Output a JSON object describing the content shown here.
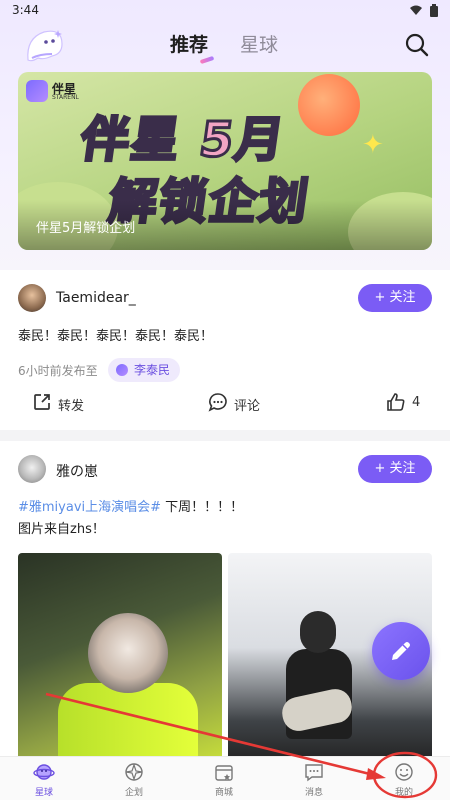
{
  "status": {
    "time": "3:44"
  },
  "header": {
    "tabs": [
      {
        "label": "推荐",
        "active": true
      },
      {
        "label": "星球",
        "active": false
      }
    ]
  },
  "banner": {
    "brand_name": "伴星",
    "brand_sub": "STARENL",
    "headline_line1": "伴星 5月",
    "headline_line2": "解锁企划",
    "caption": "伴星5月解锁企划"
  },
  "posts": [
    {
      "username": "Taemidear_",
      "follow_label": "+ 关注",
      "text": "泰民！泰民！泰民！泰民！泰民！",
      "meta": "6小时前发布至",
      "planet": "李泰民",
      "actions": {
        "share": "转发",
        "comment": "评论",
        "likes": "4"
      }
    },
    {
      "username": "雅の崽",
      "follow_label": "+ 关注",
      "hashtag": "#雅miyavi上海演唱会#",
      "text_after_tag": " 下周！！！！",
      "line2": "图片来自zhs！"
    }
  ],
  "nav": {
    "items": [
      {
        "label": "星球",
        "icon": "planet-icon",
        "active": true
      },
      {
        "label": "企划",
        "icon": "project-icon",
        "active": false
      },
      {
        "label": "商城",
        "icon": "shop-icon",
        "active": false
      },
      {
        "label": "消息",
        "icon": "message-icon",
        "active": false
      },
      {
        "label": "我的",
        "icon": "smiley-icon",
        "active": false
      }
    ]
  },
  "colors": {
    "accent": "#7b5cf5",
    "hashtag": "#5b8ee6",
    "annotation": "#e53935"
  }
}
